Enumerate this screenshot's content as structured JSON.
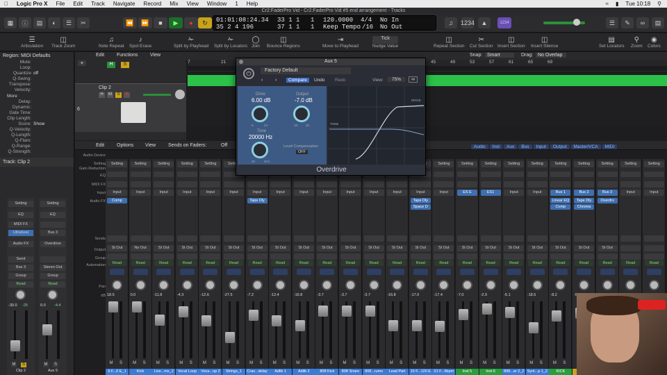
{
  "menubar": {
    "app": "Logic Pro X",
    "items": [
      "File",
      "Edit",
      "Track",
      "Navigate",
      "Record",
      "Mix",
      "View",
      "Window",
      "1",
      "Help"
    ],
    "clock": "Tue 10:18"
  },
  "window_title": "Cr2:FaderPro Vid - Cr2:FaderPro Vid #5 end arrangement - Tracks",
  "lcd": {
    "smpte": "01:01:08:24.34",
    "bars": "33 1 1",
    "ticks1": "1",
    "tempo": "120.0000",
    "sig": "4/4",
    "in": "No In",
    "pos2": "35 2 4 196",
    "bars2": "37 1 1",
    "ticks2": "1",
    "keep": "Keep Tempo",
    "div": "/16",
    "out": "No Out"
  },
  "cpu_badge": "1234",
  "toolbar": {
    "items": [
      "Articulation",
      "Track Zoom",
      "Note Repeat",
      "Spot Erase",
      "Split by Playhead",
      "Split by Locators",
      "Join",
      "Bounce Regions",
      "Move to Playhead",
      "Nudge Value",
      "Repeat Section",
      "Cut Section",
      "Insert Section",
      "Insert Silence",
      "Set Locators",
      "Zoom",
      "Colors"
    ],
    "nudge": "Tick"
  },
  "inspector": {
    "header": "Region: MIDI Defaults",
    "rows": [
      {
        "k": "Mute:",
        "v": ""
      },
      {
        "k": "Loop:",
        "v": ""
      },
      {
        "k": "Quantize",
        "v": "off"
      },
      {
        "k": "Q-Swing:",
        "v": ""
      },
      {
        "k": "Transpose:",
        "v": ""
      },
      {
        "k": "Velocity:",
        "v": ""
      }
    ],
    "more": "More",
    "more_rows": [
      {
        "k": "Delay:",
        "v": ""
      },
      {
        "k": "Dynamic:",
        "v": ""
      },
      {
        "k": "Gate Time:",
        "v": ""
      },
      {
        "k": "Clip Length:",
        "v": ""
      },
      {
        "k": "Score:",
        "v": "Show"
      },
      {
        "k": "Q-Velocity:",
        "v": ""
      },
      {
        "k": "Q-Length:",
        "v": ""
      },
      {
        "k": "Q-Flam:",
        "v": ""
      },
      {
        "k": "Q-Range:",
        "v": ""
      },
      {
        "k": "Q-Strength:",
        "v": ""
      }
    ],
    "track_header": "Track: Clip 2"
  },
  "inspector_strips": [
    {
      "setting": "Setting",
      "eq": "EQ",
      "midi": "MIDI FX",
      "inst": "Ultrabeat",
      "fx": "Audio FX",
      "send": "Send",
      "out": "Bus 3",
      "group": "Group",
      "auto": "Read",
      "vol": "-30.0",
      "peak": "-25",
      "name": "Clip 2"
    },
    {
      "setting": "Setting",
      "eq": "EQ",
      "midi": "",
      "inst": "Bus 3",
      "fx": "Overdrive",
      "send": "",
      "out": "Stereo Out",
      "group": "Group",
      "auto": "Read",
      "vol": "0.0",
      "peak": "-4.4",
      "name": "Aux 5"
    }
  ],
  "tracks_area": {
    "edit": "Edit",
    "functions": "Functions",
    "view": "View",
    "ruler": [
      "7",
      "21",
      "45",
      "49",
      "53",
      "57",
      "61",
      "65",
      "69"
    ],
    "track_name": "Clip 2",
    "track_num": "6",
    "snap_label": "Snap:",
    "snap": "Smart",
    "drag_label": "Drag:",
    "drag": "No Overlap"
  },
  "mixer_header": {
    "edit": "Edit",
    "options": "Options",
    "view": "View",
    "sends": "Sends on Faders:",
    "off": "Off",
    "tabs": [
      "Audio",
      "Inst",
      "Aux",
      "Bus",
      "Input",
      "Output",
      "Master/VCA",
      "MIDI"
    ]
  },
  "mixer_labels": [
    "Audio Device",
    "Setting",
    "Gain Reduction",
    "EQ",
    "MIDI FX",
    "Input",
    "Audio FX",
    "Sends",
    "Output",
    "Group",
    "Automation",
    "Pan",
    "dB"
  ],
  "strips": [
    {
      "name": "6 F...0 E_1",
      "fx": [
        "Comp"
      ],
      "out": "St Out",
      "vol": "18.5",
      "color": "#3a7bd5"
    },
    {
      "name": "Kick",
      "fx": [],
      "out": "No Out",
      "vol": "0.0",
      "color": "#3a7bd5"
    },
    {
      "name": "Live...ms_2",
      "fx": [],
      "out": "St Out",
      "vol": "-11.8",
      "color": "#3a7bd5"
    },
    {
      "name": "Vocal Loop",
      "fx": [],
      "out": "St Out",
      "vol": "-4.3",
      "color": "#3a7bd5"
    },
    {
      "name": "Voca...op 2",
      "fx": [],
      "out": "St Out",
      "vol": "-12.6",
      "color": "#3a7bd5"
    },
    {
      "name": "Strings_1",
      "fx": [],
      "out": "St Out",
      "vol": "-27.5",
      "color": "#3a7bd5"
    },
    {
      "name": "Cras...delay",
      "fx": [
        "Tape Dly"
      ],
      "out": "St Out",
      "vol": "-7.2",
      "color": "#3a7bd5"
    },
    {
      "name": "Adlib 1",
      "fx": [],
      "out": "St Out",
      "vol": "-12.4",
      "color": "#3a7bd5"
    },
    {
      "name": "Adlib 2",
      "fx": [],
      "out": "St Out",
      "vol": "-16.8",
      "color": "#3a7bd5"
    },
    {
      "name": "808 Kick",
      "fx": [],
      "out": "St Out",
      "vol": "-3.7",
      "color": "#3a7bd5"
    },
    {
      "name": "808 Snare",
      "fx": [],
      "out": "St Out",
      "vol": "-3.7",
      "color": "#3a7bd5"
    },
    {
      "name": "808...rums",
      "fx": [],
      "out": "St Out",
      "vol": "-3.7",
      "color": "#3a7bd5"
    },
    {
      "name": "Lead Part",
      "fx": [],
      "out": "St Out",
      "vol": "-16.8",
      "color": "#3a7bd5"
    },
    {
      "name": "10 F...120 E",
      "fx": [
        "Tape Dly",
        "Space D"
      ],
      "out": "St Out",
      "vol": "-17.0",
      "color": "#3a7bd5"
    },
    {
      "name": "01 F...6bpm",
      "fx": [],
      "out": "St Out",
      "vol": "-17.4",
      "color": "#3a7bd5"
    },
    {
      "name": "Inst 5",
      "fx": [],
      "inst": "ES E",
      "out": "St Out",
      "vol": "-7.0",
      "color": "#2a9d3f"
    },
    {
      "name": "Inst 6",
      "fx": [],
      "inst": "ES1",
      "out": "St Out",
      "vol": "-2.0",
      "color": "#2a9d3f"
    },
    {
      "name": "808...ar 2_2",
      "fx": [],
      "out": "St Out",
      "vol": "-5.1",
      "color": "#3a7bd5"
    },
    {
      "name": "Synt...p 1_2",
      "fx": [],
      "out": "St Out",
      "vol": "-18.5",
      "color": "#3a7bd5"
    },
    {
      "name": "KICK",
      "fx": [
        "Linear EQ",
        "Comp"
      ],
      "inst": "Bus 1",
      "out": "St Out",
      "vol": "-8.2",
      "color": "#2a9d3f"
    },
    {
      "name": "Aux",
      "fx": [
        "Tape Dly",
        "Chroma"
      ],
      "inst": "Bus 2",
      "out": "St Out",
      "vol": "-5.6",
      "color": "#c9a227"
    },
    {
      "name": "",
      "fx": [
        "Overdrv"
      ],
      "inst": "Bus 3",
      "out": "St Out",
      "vol": "0.0",
      "color": "#3a7bd5"
    },
    {
      "name": "",
      "fx": [],
      "out": "",
      "vol": "0.0",
      "color": "#3a7bd5"
    },
    {
      "name": "",
      "fx": [],
      "out": "",
      "vol": "0.0",
      "color": "#3a7bd5"
    }
  ],
  "plugin": {
    "title": "Aux 5",
    "preset": "Factory Default",
    "compare": "Compare",
    "undo": "Undo",
    "redo": "Redo",
    "view_label": "View:",
    "view": "75%",
    "drive_label": "Drive",
    "drive": "6.00 dB",
    "output_label": "Output",
    "output": "-7.0 dB",
    "tone_label": "Tone",
    "tone": "20000 Hz",
    "level_comp": "Level Compensation",
    "level_comp_val": "OFF",
    "name": "Overdrive",
    "graph_drive": "DRIVE",
    "graph_tone": "TONE",
    "drive_min": "0",
    "drive_max": "24",
    "out_min": "-40",
    "out_max": "20",
    "tone_min": "20",
    "tone_max": "20 k"
  }
}
